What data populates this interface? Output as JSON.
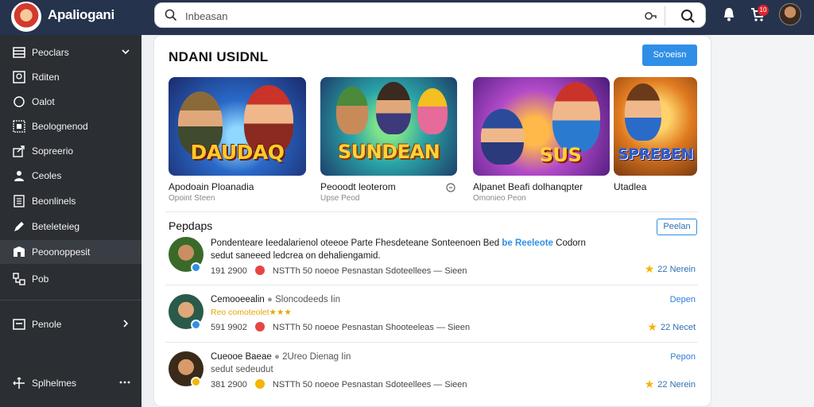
{
  "app": {
    "title": "Apaliogani"
  },
  "search": {
    "placeholder": "Inbeasan"
  },
  "topbar": {
    "icons": [
      "bell-icon",
      "cart-icon"
    ],
    "badge": "10"
  },
  "sidebar": {
    "items": [
      {
        "label": "Peoclars",
        "icon": "list-icon"
      },
      {
        "label": "Rditen",
        "icon": "image-icon"
      },
      {
        "label": "Oalot",
        "icon": "circle-icon"
      },
      {
        "label": "Beolognenod",
        "icon": "grid-icon"
      },
      {
        "label": "Sopreerio",
        "icon": "share-icon"
      },
      {
        "label": "Ceoles",
        "icon": "user-icon"
      },
      {
        "label": "Beonlinels",
        "icon": "document-icon"
      },
      {
        "label": "Beteleteieg",
        "icon": "pen-icon"
      },
      {
        "label": "Peoonoppesit",
        "icon": "folder-icon"
      },
      {
        "label": "Pob",
        "icon": "network-icon"
      },
      {
        "label": "Penole",
        "icon": "page-icon"
      },
      {
        "label": "Splhelmes",
        "icon": "arrows-icon"
      }
    ]
  },
  "main": {
    "title": "NDANI USIDNL",
    "action_label": "So'oeisn",
    "games": [
      {
        "name": "Apodoain Ploanadia",
        "sub": "Opoint Steen",
        "logo": "DAUDAQ"
      },
      {
        "name": "Peooodt leoterom",
        "sub": "Upse Peod",
        "logo": "SUNDEAN"
      },
      {
        "name": "Alpanet Beafi dolhanqpter",
        "sub": "Omonieo Peon",
        "logo": "SUS"
      },
      {
        "name": "Utadlea",
        "sub": "",
        "logo": "SPREBEN"
      }
    ],
    "section_title": "Pepdaps",
    "section_button": "Peelan",
    "reviews": [
      {
        "line1": "Pondenteare Ieedalarienol oteeoe Parte Fhesdeteane Sonteenoen Bed",
        "line1_highlight": "be Reeleote",
        "line1_tail": "Codorn",
        "line2": "sedut saneeed ledcrea on dehaliengamid.",
        "meta_num": "191 2900",
        "meta_rest": "NSTTh 50 noeoe Pesnastan Sdoteellees — Sieen",
        "link": "",
        "rating": "22 Nerein"
      },
      {
        "line1": "Cemooeealin",
        "line1_extra": "Sloncodeeds Iin",
        "line2": "Reo comoteolet★★★",
        "meta_num": "591 9902",
        "meta_rest": "NSTTh 50 noeoe Pesnastan Shooteeleas — Sieen",
        "link": "Depen",
        "rating": "22 Necet"
      },
      {
        "line1": "Cueooe Baeae",
        "line1_extra": "2Ureo Dienag Iin",
        "line2": "sedut sedeudut",
        "meta_num": "381 2900",
        "meta_rest": "NSTTh 50 noeoe Pesnastan Sdoteellees — Sieen",
        "link": "Pepon",
        "rating": "22 Nerein"
      }
    ]
  }
}
